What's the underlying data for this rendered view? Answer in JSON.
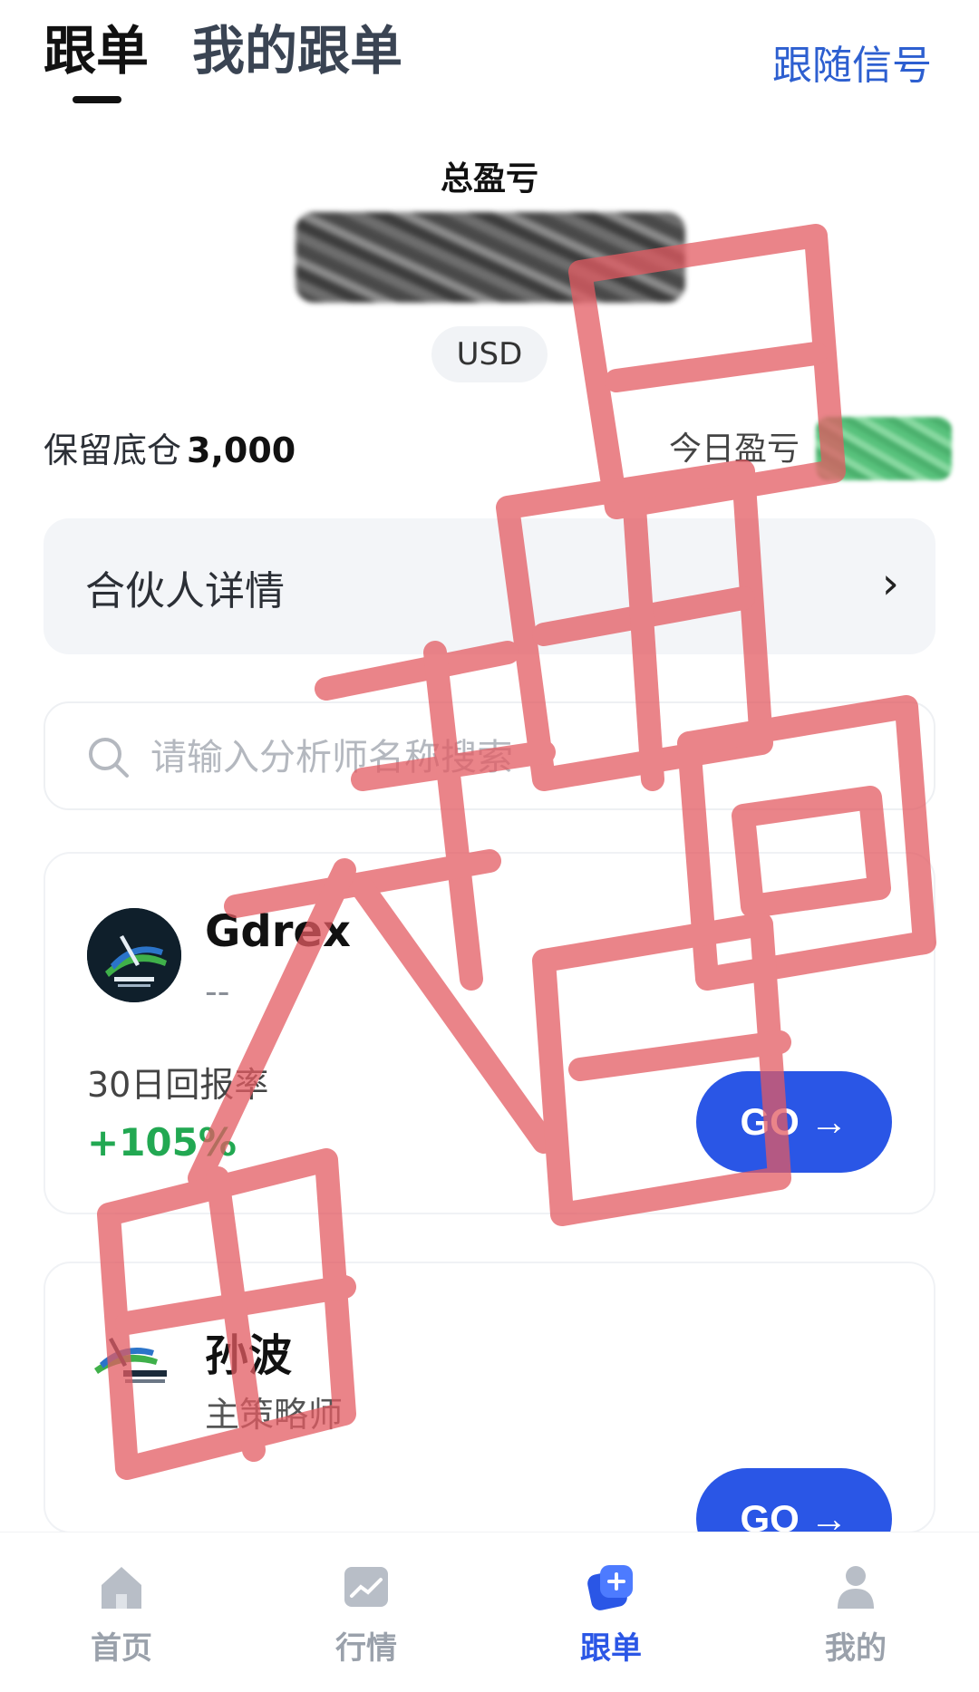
{
  "header": {
    "tabs": [
      {
        "label": "跟单",
        "active": true
      },
      {
        "label": "我的跟单",
        "active": false
      }
    ],
    "follow_signal": "跟随信号"
  },
  "summary": {
    "total_pnl_label": "总盈亏",
    "currency": "USD",
    "reserve_label": "保留底仓",
    "reserve_value": "3,000",
    "today_pnl_label": "今日盈亏"
  },
  "partner": {
    "label": "合伙人详情",
    "chevron_icon": "chevron-right-icon"
  },
  "search": {
    "placeholder": "请输入分析师名称搜索",
    "value": ""
  },
  "traders": [
    {
      "name": "Gdrex",
      "subtitle": "--",
      "return_label": "30日回报率",
      "return_value": "+105%",
      "go_label": "GO →"
    },
    {
      "name": "孙波",
      "subtitle": "主策略师",
      "go_label": "GO →"
    }
  ],
  "nav": {
    "items": [
      {
        "label": "首页",
        "icon": "home-icon",
        "active": false
      },
      {
        "label": "行情",
        "icon": "market-chart-icon",
        "active": false
      },
      {
        "label": "跟单",
        "icon": "copy-trade-icon",
        "active": true
      },
      {
        "label": "我的",
        "icon": "user-icon",
        "active": false
      }
    ]
  },
  "watermark": {
    "text": "新天鸿鹏骗子"
  },
  "colors": {
    "accent": "#2a56e6",
    "positive": "#22a852",
    "watermark": "#e35b62"
  }
}
